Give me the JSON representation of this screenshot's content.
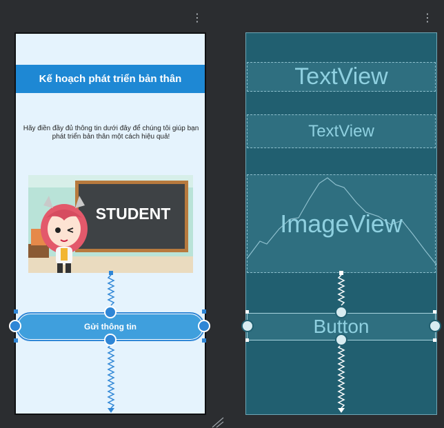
{
  "app": {
    "design_title": "Kế hoạch phát triển bản thân",
    "design_description": "Hãy điền đầy đủ thông tin dưới đây để chúng tôi giúp bạn phát triển bản thân một cách hiệu quả!",
    "illustration_text": "STUDENT",
    "button_label": "Gửi thông tin"
  },
  "blueprint": {
    "textview1": "TextView",
    "textview2": "TextView",
    "imageview": "ImageView",
    "button": "Button"
  },
  "icons": {
    "more": "more-vert-icon",
    "resize": "resize-handle-icon"
  },
  "colors": {
    "editor_bg": "#2b2d30",
    "design_bg": "#e5f3fd",
    "title_bar": "#1e88d4",
    "button": "#3f9fdd",
    "blueprint_bg": "#215f70",
    "constraint": "#2f86d6"
  }
}
